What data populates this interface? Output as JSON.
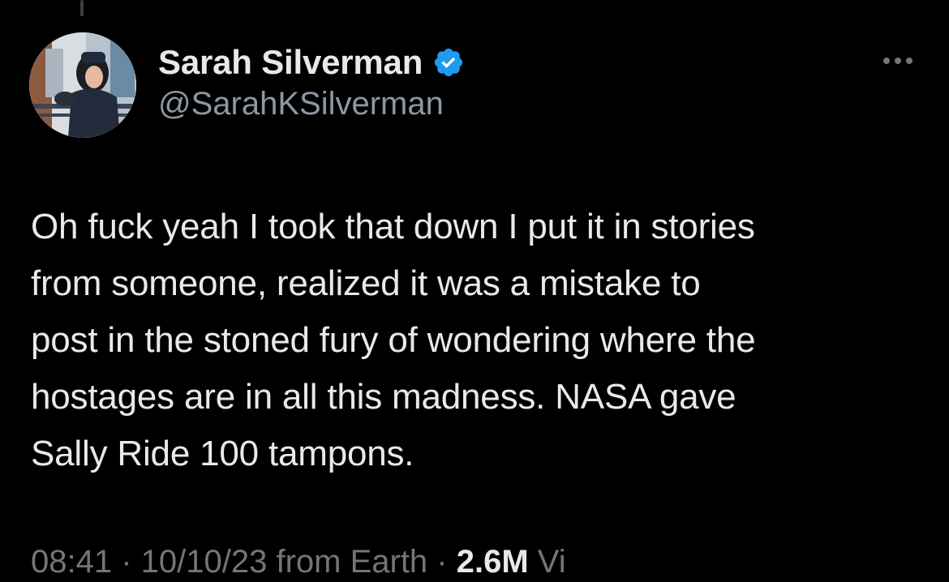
{
  "tweet": {
    "author": {
      "display_name": "Sarah Silverman",
      "handle": "@SarahKSilverman",
      "verified": true,
      "avatar": "avatar-photo"
    },
    "text": "Oh fuck yeah I took that down I put it in stories\nfrom someone, realized it was a mistake to\npost in the stoned fury of wondering where the\nhostages are in all this madness. NASA gave\nSally Ride 100 tampons.",
    "meta_partial": "08:41 · 10/10/23 from Earth ·",
    "views_partial": "2.6M",
    "views_label_partial": " Vi"
  },
  "icons": {
    "verified": "verified-badge-icon",
    "more": "more-options-icon"
  },
  "colors": {
    "background": "#000000",
    "text_primary": "#e7e9ea",
    "text_secondary": "#8b98a5",
    "verified_blue": "#1d9bf0"
  }
}
